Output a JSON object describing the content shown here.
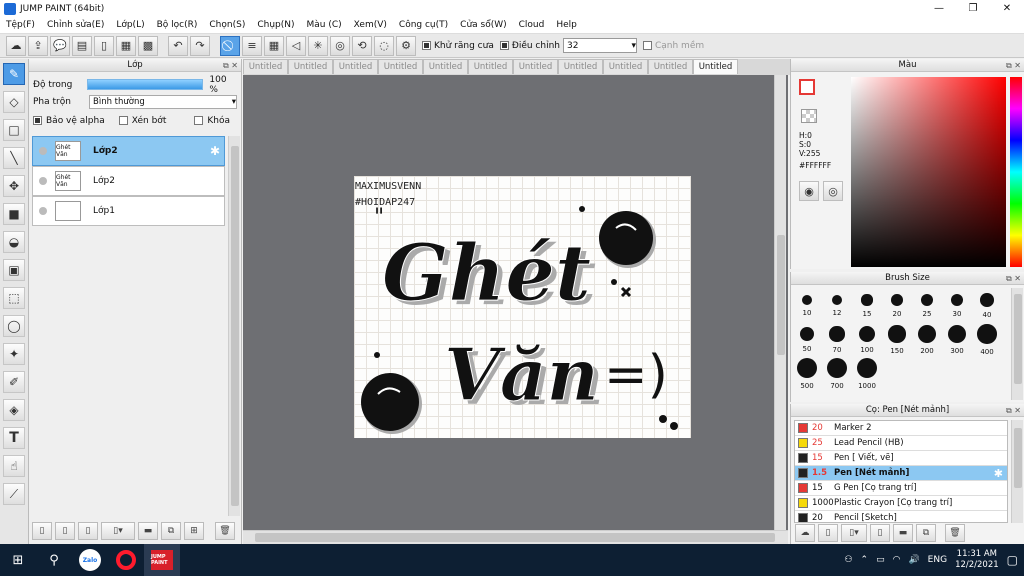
{
  "window": {
    "title": "JUMP PAINT (64bit)",
    "min": "—",
    "max": "❐",
    "close": "✕"
  },
  "menu": [
    "Tệp(F)",
    "Chỉnh sửa(E)",
    "Lớp(L)",
    "Bộ lọc(R)",
    "Chọn(S)",
    "Chụp(N)",
    "Màu (C)",
    "Xem(V)",
    "Công cụ(T)",
    "Cửa sổ(W)",
    "Cloud",
    "Help"
  ],
  "toolbar": {
    "antialias_label": "Khử răng cưa",
    "correction_label": "Điều chỉnh",
    "correction_value": "32",
    "smooth_label": "Cạnh mềm",
    "dropdown_arrow": "▾"
  },
  "layer_panel": {
    "title": "Lớp",
    "opacity_label": "Độ trong",
    "opacity_value": "100 %",
    "opacity": 1.0,
    "blend_label": "Pha trộn",
    "blend_value": "Bình thường",
    "protect_alpha": "Bảo vệ alpha",
    "clipping": "Xén bớt",
    "lock": "Khóa",
    "layers": [
      {
        "name": "Lớp2",
        "thumb": "Ghét Văn",
        "selected": true
      },
      {
        "name": "Lớp2",
        "thumb": "Ghét Văn",
        "selected": false
      },
      {
        "name": "Lớp1",
        "thumb": "",
        "selected": false
      }
    ]
  },
  "tabs": [
    "Untitled",
    "Untitled",
    "Untitled",
    "Untitled",
    "Untitled",
    "Untitled",
    "Untitled",
    "Untitled",
    "Untitled",
    "Untitled",
    "Untitled"
  ],
  "artwork": {
    "line1": "MAXIMUSVENN",
    "line2": "#HOIDAP247",
    "word1": "Ghét",
    "word2": "Văn",
    "emoticon": "=)"
  },
  "color_panel": {
    "title": "Màu",
    "h": "H:0",
    "s": "S:0",
    "v": "V:255",
    "hex": "#FFFFFF",
    "primary": "#ffffff",
    "secondary": "#000000"
  },
  "brush_panel": {
    "title": "Brush Size",
    "sizes": [
      "10",
      "12",
      "15",
      "20",
      "25",
      "30",
      "40",
      "50",
      "70",
      "100",
      "150",
      "200",
      "300",
      "400",
      "500",
      "700",
      "1000"
    ]
  },
  "pen_panel": {
    "title": "Cọ: Pen [Nét mảnh]",
    "items": [
      {
        "size": "20",
        "name": "Marker 2",
        "color": "#e53935",
        "selected": false
      },
      {
        "size": "25",
        "name": "Lead Pencil (HB)",
        "color": "#f6d90a",
        "selected": false
      },
      {
        "size": "15",
        "name": "Pen [ Viết, vẽ]",
        "color": "#222222",
        "selected": false
      },
      {
        "size": "1.5",
        "name": "Pen [Nét mảnh]",
        "color": "#222222",
        "selected": true
      },
      {
        "size": "15",
        "name": "G Pen [Cọ trang trí]",
        "color": "#e53935",
        "selected": false
      },
      {
        "size": "1000",
        "name": "Plastic Crayon [Cọ trang trí]",
        "color": "#f6d90a",
        "selected": false
      },
      {
        "size": "20",
        "name": "Pencil [Sketch]",
        "color": "#222222",
        "selected": false
      }
    ]
  },
  "taskbar": {
    "lang": "ENG",
    "time": "11:31 AM",
    "date": "12/2/2021",
    "zalo": "Zalo",
    "app": "JUMP PAINT"
  }
}
